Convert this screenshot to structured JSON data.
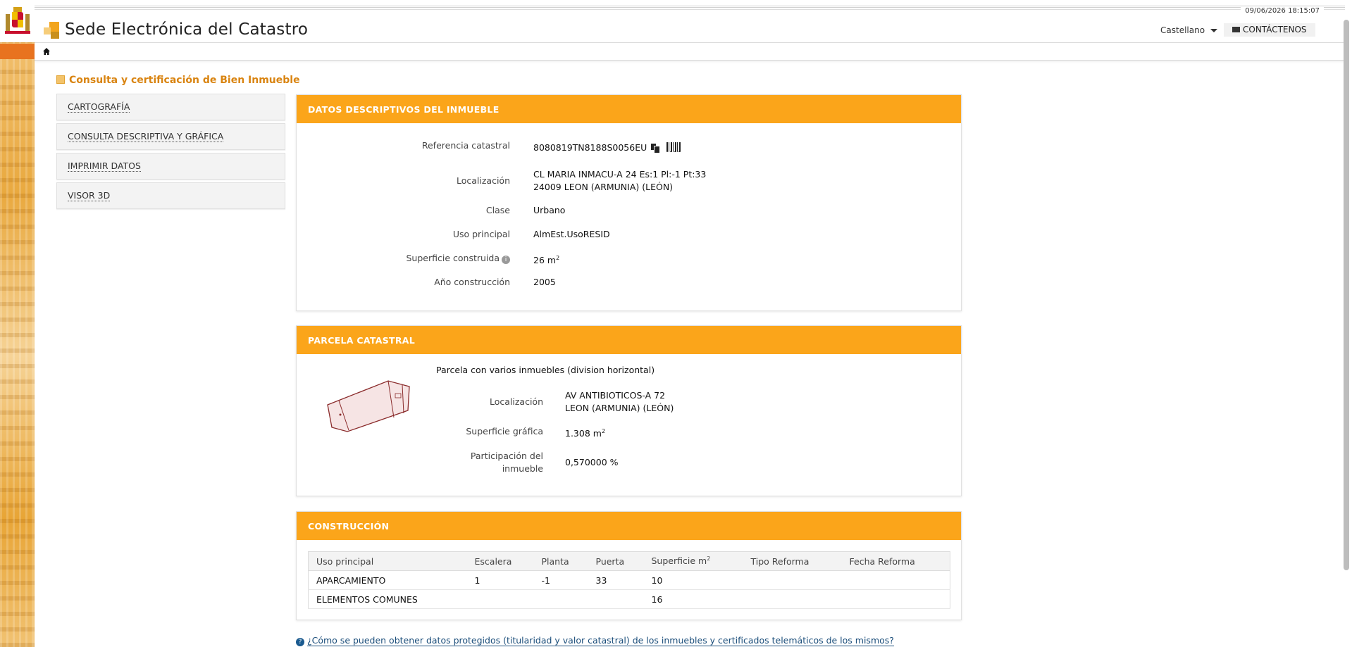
{
  "header": {
    "datetime": "09/06/2026  18:15:07",
    "site_title": "Sede Electrónica del Catastro",
    "language": "Castellano",
    "contact_label": "CONTÁCTENOS"
  },
  "page_heading": "Consulta y certificación de Bien Inmueble",
  "menu": {
    "items": [
      {
        "label": "CARTOGRAFÍA"
      },
      {
        "label": "CONSULTA DESCRIPTIVA Y GRÁFICA"
      },
      {
        "label": "IMPRIMIR DATOS"
      },
      {
        "label": "VISOR 3D"
      }
    ]
  },
  "datos_descriptivos": {
    "title": "DATOS DESCRIPTIVOS DEL INMUEBLE",
    "referencia_label": "Referencia catastral",
    "referencia_value": "8080819TN8188S0056EU",
    "localizacion_label": "Localización",
    "localizacion_line1": "CL MARIA INMACU-A 24 Es:1 Pl:-1 Pt:33",
    "localizacion_line2": "24009 LEON (ARMUNIA) (LEÓN)",
    "clase_label": "Clase",
    "clase_value": "Urbano",
    "uso_label": "Uso principal",
    "uso_value": "AlmEst.UsoRESID",
    "superficie_label": "Superficie construida",
    "superficie_value": "26 m",
    "superficie_unit_sup": "2",
    "anio_label": "Año construcción",
    "anio_value": "2005"
  },
  "parcela": {
    "title": "PARCELA CATASTRAL",
    "description": "Parcela con varios inmuebles (division horizontal)",
    "localizacion_label": "Localización",
    "localizacion_line1": "AV ANTIBIOTICOS-A 72",
    "localizacion_line2": "LEON (ARMUNIA) (LEÓN)",
    "superficie_label": "Superficie gráfica",
    "superficie_value": "1.308 m",
    "superficie_unit_sup": "2",
    "participacion_label_1": "Participación del",
    "participacion_label_2": "inmueble",
    "participacion_value": "0,570000 %"
  },
  "construccion": {
    "title": "CONSTRUCCIÓN",
    "columns": [
      "Uso principal",
      "Escalera",
      "Planta",
      "Puerta",
      "Superficie m",
      "Tipo Reforma",
      "Fecha Reforma"
    ],
    "superficie_sup": "2",
    "rows": [
      [
        "APARCAMIENTO",
        "1",
        "-1",
        "33",
        "10",
        "",
        ""
      ],
      [
        "ELEMENTOS COMUNES",
        "",
        "",
        "",
        "16",
        "",
        ""
      ]
    ]
  },
  "help_link": "¿Cómo se pueden obtener datos protegidos (titularidad y valor catastral) de los inmuebles y certificados telemáticos de los mismos?",
  "icons": {
    "crest": "spain-coat-of-arms-icon",
    "home": "home-icon",
    "mail": "mail-icon",
    "info": "info-icon",
    "copy": "copy-icon",
    "barcode": "barcode-icon",
    "help": "question-icon"
  },
  "colors": {
    "accent_orange": "#fba51a",
    "heading_orange": "#d98411",
    "link_blue": "#1a4d7a"
  }
}
